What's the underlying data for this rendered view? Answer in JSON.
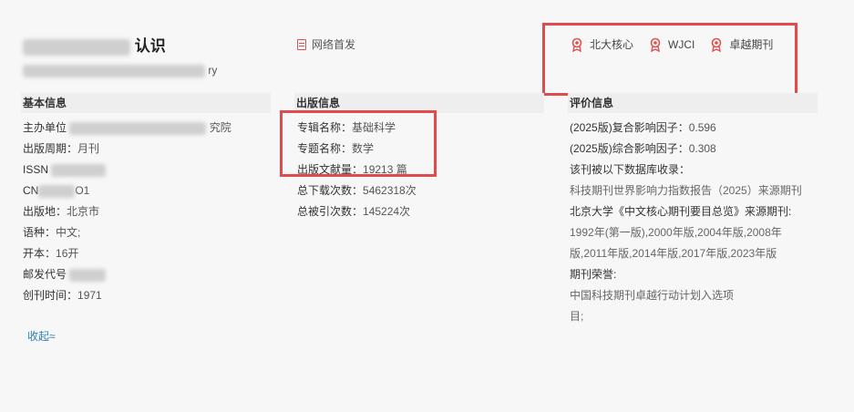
{
  "header": {
    "title_visible": "认识",
    "subtitle_visible": "ry",
    "first_publish": "网络首发"
  },
  "badges": [
    {
      "label": "北大核心",
      "icon": "award-icon"
    },
    {
      "label": "WJCI",
      "icon": "award-icon"
    },
    {
      "label": "卓越期刊",
      "icon": "award-icon"
    }
  ],
  "basic": {
    "heading": "基本信息",
    "sponsor_label": "主办单位",
    "sponsor_tail": "究院",
    "cycle_label": "出版周期：",
    "cycle_value": "月刊",
    "issn_label": "ISSN",
    "cn_label": "CN",
    "cn_tail": "O1",
    "place_label": "出版地：",
    "place_value": "北京市",
    "lang_label": "语种：",
    "lang_value": "中文;",
    "format_label": "开本：",
    "format_value": "16开",
    "postal_label": "邮发代号",
    "founded_label": "创刊时间：",
    "founded_value": "1971",
    "collapse": "收起≈"
  },
  "publish": {
    "heading": "出版信息",
    "album_label": "专辑名称：",
    "album_value": "基础科学",
    "topic_label": "专题名称：",
    "topic_value": "数学",
    "volume_label": "出版文献量：",
    "volume_value": "19213 篇",
    "downloads_label": "总下载次数：",
    "downloads_value": "5462318次",
    "citations_label": "总被引次数：",
    "citations_value": "145224次"
  },
  "evaluation": {
    "heading": "评价信息",
    "if_composite_label": "(2025版)复合影响因子：",
    "if_composite_value": "0.596",
    "if_synthesis_label": "(2025版)综合影响因子：",
    "if_synthesis_value": "0.308",
    "indexed_label": "该刊被以下数据库收录：",
    "indexed_value": "科技期刊世界影响力指数报告（2025）来源期刊",
    "pku_label": "北京大学《中文核心期刊要目总览》来源期刊:",
    "pku_value_1": "1992年(第一版),2000年版,2004年版,2008年",
    "pku_value_2": "版,2011年版,2014年版,2017年版,2023年版",
    "honor_label": "期刊荣誉:",
    "honor_value_1": "中国科技期刊卓越行动计划入选项",
    "honor_value_2": "目;"
  },
  "colors": {
    "highlight_box": "#e04b4b",
    "link": "#2c7fb8",
    "icon": "#d9534f"
  }
}
